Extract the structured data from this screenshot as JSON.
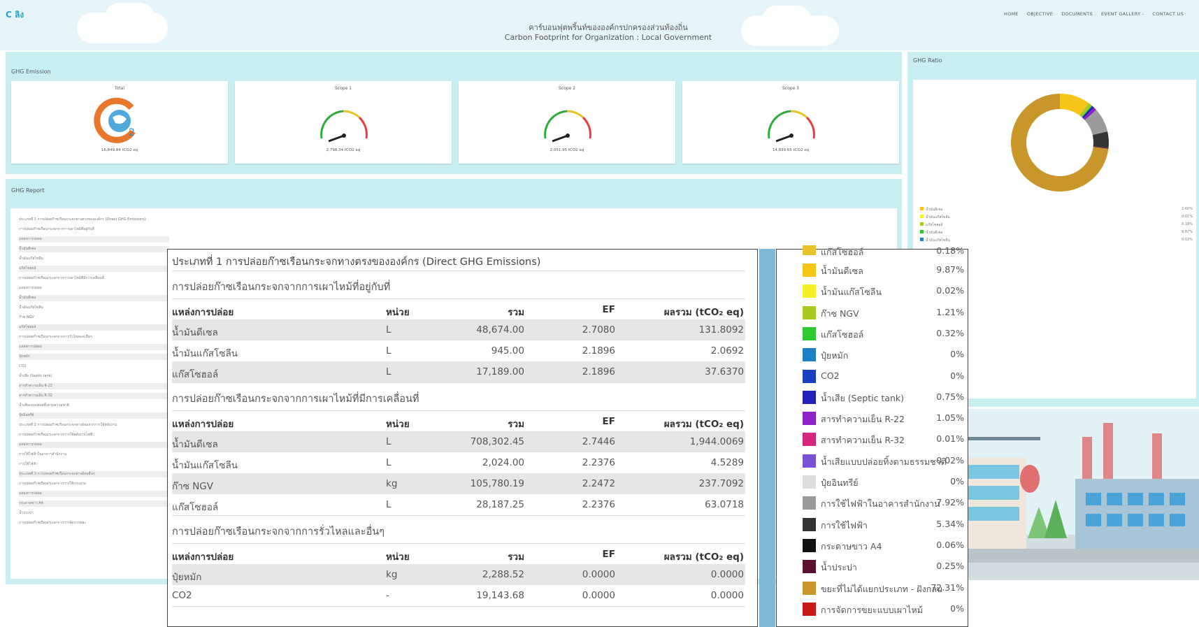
{
  "header": {
    "logo": "C ลิง",
    "title_th": "คาร์บอนฟุตพริ้นท์ขององค์กรปกครองส่วนท้องถิ่น",
    "title_en": "Carbon Footprint for Organization : Local Government",
    "nav": [
      "HOME",
      "OBJECTIVE",
      "DOCUMENTS",
      "EVENT GALLERY -",
      "CONTACT US"
    ]
  },
  "emission": {
    "title": "GHG Emission",
    "cards": [
      {
        "label": "Total",
        "value": "16,849.84 tCO2 eq"
      },
      {
        "label": "Scope 1",
        "value": "2,798.34 tCO2 eq"
      },
      {
        "label": "Scope 2",
        "value": "2,051.95 tCO2 eq"
      },
      {
        "label": "Scope 3",
        "value": "14,839.65 tCO2 eq"
      }
    ],
    "gauge_ticks": [
      "0",
      "1.5K",
      "3K",
      "4.5K",
      "6K"
    ]
  },
  "report": {
    "title": "GHG Report",
    "rows": [
      "ประเภทที่ 1 การปล่อยก๊าซเรือนกระจกทางตรงขององค์กร (Direct GHG Emissions)",
      "การปล่อยก๊าซเรือนกระจกจากการเผาไหม้ที่อยู่กับที่",
      "แหล่งการปล่อย",
      "น้ำมันดีเซล",
      "น้ำมันแก๊สโซลีน",
      "แก๊สโซฮอล์",
      "การปล่อยก๊าซเรือนกระจกจากการเผาไหม้ที่มีการเคลื่อนที่",
      "แหล่งการปล่อย",
      "น้ำมันดีเซล",
      "น้ำมันแก๊สโซลีน",
      "ก๊าซ NGV",
      "แก๊สโซฮอล์",
      "การปล่อยก๊าซเรือนกระจกจากการรั่วไหลและอื่นๆ",
      "แหล่งการปล่อย",
      "ปุ๋ยหมัก",
      "CO2",
      "น้ำเสีย (Septic tank)",
      "สารทำความเย็น R-22",
      "สารทำความเย็น R-32",
      "น้ำเสียแบบปล่อยทิ้งตามธรรมชาติ",
      "ปุ๋ยอินทรีย์",
      "ประเภทที่ 2 การปล่อยก๊าซเรือนกระจกทางอ้อมจากการใช้พลังงาน",
      "การปล่อยก๊าซเรือนกระจกจากการใช้พลังงานไฟฟ้า",
      "แหล่งการปล่อย",
      "การใช้ไฟฟ้าในอาคารสำนักงาน",
      "การใช้ไฟฟ้า",
      "ประเภทที่ 3 การปล่อยก๊าซเรือนกระจกทางอ้อมอื่นๆ",
      "การปล่อยก๊าซเรือนกระจกจากการใช้กระดาษ",
      "แหล่งการปล่อย",
      "กระดาษขาว A4",
      "น้ำประปา",
      "การปล่อยก๊าซเรือนกระจกจากการจัดการขยะ"
    ]
  },
  "ratio": {
    "title": "GHG Ratio",
    "mini_legend": [
      {
        "label": "น้ำมันดีเซล",
        "pct": "2.60%"
      },
      {
        "label": "น้ำมันแก๊สโซลีน",
        "pct": "0.01%"
      },
      {
        "label": "แก๊สโซฮอล์",
        "pct": "0.18%"
      },
      {
        "label": "น้ำมันดีเซล",
        "pct": "9.87%"
      },
      {
        "label": "น้ำมันแก๊สโซลีน",
        "pct": "0.02%"
      }
    ]
  },
  "chart_data": {
    "type": "pie",
    "categories": [
      "น้ำมันดีเซล",
      "น้ำมันแก๊สโซลีน",
      "ก๊าซ NGV",
      "แก๊สโซฮอล์",
      "ปุ๋ยหมัก",
      "CO2",
      "น้ำเสีย (Septic tank)",
      "สารทำความเย็น R-22",
      "สารทำความเย็น R-32",
      "น้ำเสียแบบปล่อยทิ้งตามธรรมชาติ",
      "ปุ๋ยอินทรีย์",
      "การใช้ไฟฟ้าในอาคารสำนักงาน",
      "การใช้ไฟฟ้า",
      "กระดาษขาว A4",
      "น้ำประปา",
      "ขยะที่ไม่ได้แยกประเภท - ฝังกลบ",
      "การจัดการขยะแบบเผาไหม้"
    ],
    "values": [
      9.87,
      0.02,
      1.21,
      0.32,
      0,
      0,
      0.75,
      1.05,
      0.01,
      0.02,
      0,
      7.92,
      5.34,
      0.06,
      0.25,
      72.31,
      0
    ],
    "colors": [
      "#f5c518",
      "#f5f02a",
      "#a6c820",
      "#2ec92e",
      "#1e7fc8",
      "#1b3fc1",
      "#2222b8",
      "#8e22c8",
      "#d4267a",
      "#7b4fd8",
      "#dddddd",
      "#9a9a9a",
      "#333333",
      "#111111",
      "#5c1030",
      "#c8962a",
      "#c81818"
    ]
  },
  "overlay": {
    "heading": "ประเภทที่ 1 การปล่อยก๊าซเรือนกระจกทางตรงขององค์กร (Direct GHG Emissions)",
    "headers": {
      "source": "แหล่งการปล่อย",
      "unit": "หน่วย",
      "total": "รวม",
      "ef": "EF",
      "sum": "ผลรวม (tCO₂ eq)"
    },
    "sections": [
      {
        "title": "การปล่อยก๊าซเรือนกระจกจากการเผาไหม้ที่อยู่กับที่",
        "rows": [
          {
            "source": "น้ำมันดีเซล",
            "unit": "L",
            "total": "48,674.00",
            "ef": "2.7080",
            "sum": "131.8092"
          },
          {
            "source": "น้ำมันแก๊สโซลีน",
            "unit": "L",
            "total": "945.00",
            "ef": "2.1896",
            "sum": "2.0692"
          },
          {
            "source": "แก๊สโซฮอล์",
            "unit": "L",
            "total": "17,189.00",
            "ef": "2.1896",
            "sum": "37.6370"
          }
        ]
      },
      {
        "title": "การปล่อยก๊าซเรือนกระจกจากการเผาไหม้ที่มีการเคลื่อนที่",
        "rows": [
          {
            "source": "น้ำมันดีเซล",
            "unit": "L",
            "total": "708,302.45",
            "ef": "2.7446",
            "sum": "1,944.0069"
          },
          {
            "source": "น้ำมันแก๊สโซลีน",
            "unit": "L",
            "total": "2,024.00",
            "ef": "2.2376",
            "sum": "4.5289"
          },
          {
            "source": "ก๊าซ NGV",
            "unit": "kg",
            "total": "105,780.19",
            "ef": "2.2472",
            "sum": "237.7092"
          },
          {
            "source": "แก๊สโซฮอล์",
            "unit": "L",
            "total": "28,187.25",
            "ef": "2.2376",
            "sum": "63.0718"
          }
        ]
      },
      {
        "title": "การปล่อยก๊าซเรือนกระจกจากการรั่วไหลและอื่นๆ",
        "rows": [
          {
            "source": "ปุ๋ยหมัก",
            "unit": "kg",
            "total": "2,288.52",
            "ef": "0.0000",
            "sum": "0.0000"
          },
          {
            "source": "CO2",
            "unit": "-",
            "total": "19,143.68",
            "ef": "0.0000",
            "sum": "0.0000"
          }
        ]
      }
    ]
  },
  "legend": {
    "cut_top_label": "แก๊สโซฮอล์",
    "cut_top_pct": "0.18%",
    "items": [
      {
        "label": "น้ำมันดีเซล",
        "pct": "9.87%",
        "color": "#f5c518"
      },
      {
        "label": "น้ำมันแก๊สโซลีน",
        "pct": "0.02%",
        "color": "#f5f02a"
      },
      {
        "label": "ก๊าซ NGV",
        "pct": "1.21%",
        "color": "#a6c820"
      },
      {
        "label": "แก๊สโซฮอล์",
        "pct": "0.32%",
        "color": "#2ec92e"
      },
      {
        "label": "ปุ๋ยหมัก",
        "pct": "0%",
        "color": "#1e7fc8"
      },
      {
        "label": "CO2",
        "pct": "0%",
        "color": "#1b3fc1"
      },
      {
        "label": "น้ำเสีย (Septic tank)",
        "pct": "0.75%",
        "color": "#2222b8"
      },
      {
        "label": "สารทำความเย็น R-22",
        "pct": "1.05%",
        "color": "#8e22c8"
      },
      {
        "label": "สารทำความเย็น R-32",
        "pct": "0.01%",
        "color": "#d4267a"
      },
      {
        "label": "น้ำเสียแบบปล่อยทิ้งตามธรรมชาติ",
        "pct": "0.02%",
        "color": "#7b4fd8"
      },
      {
        "label": "ปุ๋ยอินทรีย์",
        "pct": "0%",
        "color": "#dddddd"
      },
      {
        "label": "การใช้ไฟฟ้าในอาคารสำนักงาน",
        "pct": "7.92%",
        "color": "#9a9a9a"
      },
      {
        "label": "การใช้ไฟฟ้า",
        "pct": "5.34%",
        "color": "#333333"
      },
      {
        "label": "กระดาษขาว A4",
        "pct": "0.06%",
        "color": "#111111"
      },
      {
        "label": "น้ำประปา",
        "pct": "0.25%",
        "color": "#5c1030"
      },
      {
        "label": "ขยะที่ไม่ได้แยกประเภท - ฝังกลบ",
        "pct": "72.31%",
        "color": "#c8962a"
      },
      {
        "label": "การจัดการขยะแบบเผาไหม้",
        "pct": "0%",
        "color": "#c81818"
      }
    ]
  }
}
